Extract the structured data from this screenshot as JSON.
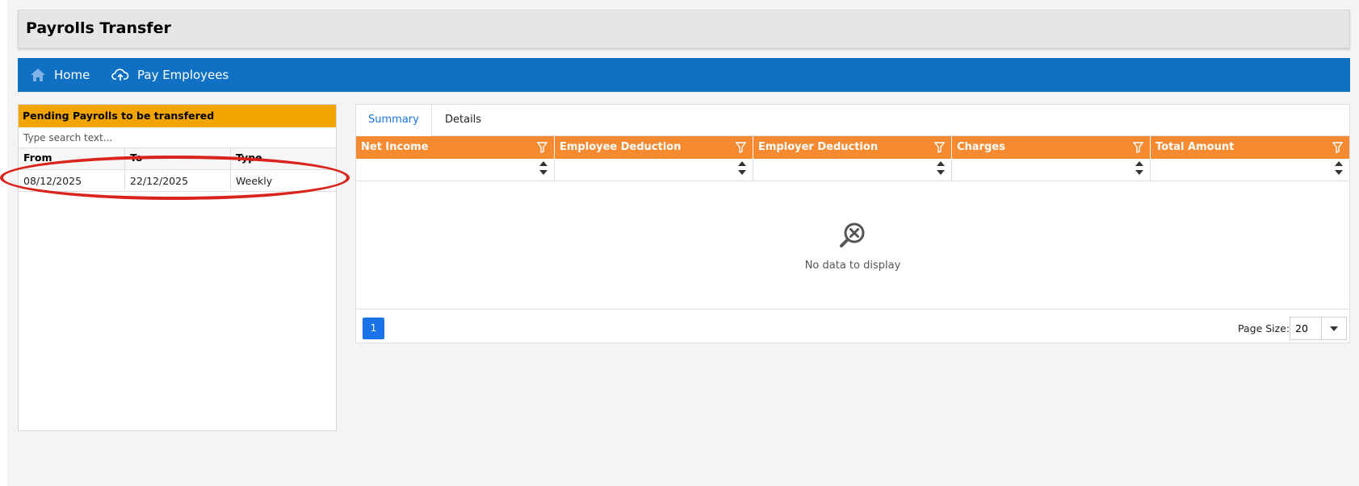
{
  "title": "Payrolls Transfer",
  "nav": {
    "home": "Home",
    "pay_employees": "Pay Employees"
  },
  "pending": {
    "header": "Pending Payrolls to be transfered",
    "search_placeholder": "Type search text...",
    "columns": [
      "From",
      "To",
      "Type"
    ],
    "rows": [
      {
        "from": "08/12/2025",
        "to": "22/12/2025",
        "type": "Weekly"
      }
    ]
  },
  "tabs": {
    "summary": "Summary",
    "details": "Details",
    "active": "Summary"
  },
  "summary_grid": {
    "columns": [
      "Net Income",
      "Employee Deduction",
      "Employer Deduction",
      "Charges",
      "Total Amount"
    ],
    "empty_text": "No data to display",
    "page": "1",
    "page_size_label": "Page Size:",
    "page_size": "20"
  },
  "colors": {
    "nav": "#0f70c4",
    "pending_header": "#f2a500",
    "grid_header": "#f68a31",
    "accent": "#1a73e8",
    "annotation": "#d9231c"
  }
}
